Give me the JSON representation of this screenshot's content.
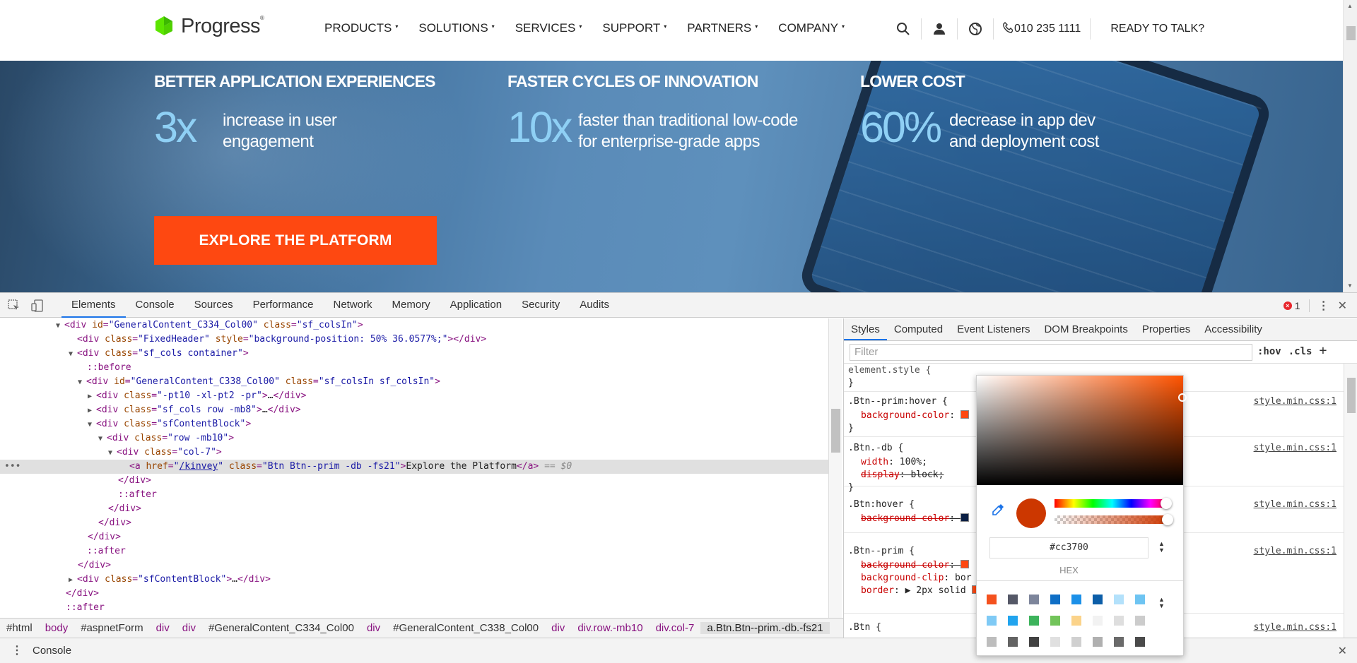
{
  "site": {
    "logo_text": "Progress",
    "nav": [
      "PRODUCTS",
      "SOLUTIONS",
      "SERVICES",
      "SUPPORT",
      "PARTNERS",
      "COMPANY"
    ],
    "phone": "010 235 1111",
    "cta": "READY TO TALK?"
  },
  "hero": {
    "stats": [
      {
        "heading": "BETTER APPLICATION EXPERIENCES",
        "big": "3x",
        "desc1": "increase in user",
        "desc2": "engagement"
      },
      {
        "heading": "FASTER CYCLES OF INNOVATION",
        "big": "10x",
        "desc1": "faster than traditional low-code",
        "desc2": "for enterprise-grade apps"
      },
      {
        "heading": "LOWER COST",
        "big": "60%",
        "desc1": "decrease in app dev",
        "desc2": "and deployment cost"
      }
    ],
    "button": "EXPLORE THE PLATFORM"
  },
  "devtools": {
    "tabs": [
      "Elements",
      "Console",
      "Sources",
      "Performance",
      "Network",
      "Memory",
      "Application",
      "Security",
      "Audits"
    ],
    "active_tab": "Elements",
    "error_count": "1",
    "side_tabs": [
      "Styles",
      "Computed",
      "Event Listeners",
      "DOM Breakpoints",
      "Properties",
      "Accessibility"
    ],
    "filter_placeholder": "Filter",
    "hov": ":hov",
    "cls": ".cls",
    "breadcrumbs": [
      "#html",
      "body",
      "#aspnetForm",
      "div",
      "div",
      "#GeneralContent_C334_Col00",
      "div",
      "#GeneralContent_C338_Col00",
      "div",
      "div.row.-mb10",
      "div.col-7",
      "a.Btn.Btn--prim.-db.-fs21"
    ],
    "drawer": "Console",
    "picker": {
      "hex": "#cc3700",
      "mode": "HEX"
    },
    "accent": "#1a73e8"
  }
}
